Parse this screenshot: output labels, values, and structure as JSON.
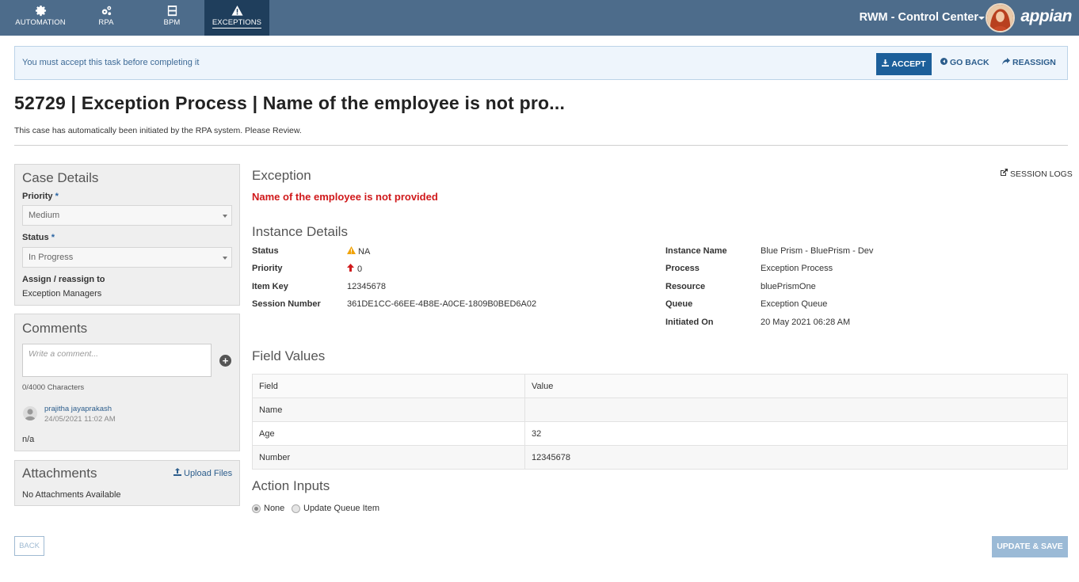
{
  "nav": {
    "tabs": [
      {
        "label": "AUTOMATION",
        "icon": "gear-icon"
      },
      {
        "label": "RPA",
        "icon": "gears-icon"
      },
      {
        "label": "BPM",
        "icon": "inbox-icon"
      },
      {
        "label": "EXCEPTIONS",
        "icon": "warning-icon",
        "active": true
      }
    ],
    "app_title": "RWM - Control Center",
    "logo": "appian"
  },
  "banner": {
    "message": "You must accept this task before completing it",
    "accept_label": "ACCEPT",
    "go_back_label": "GO BACK",
    "reassign_label": "REASSIGN"
  },
  "page": {
    "title": "52729 | Exception Process | Name of the employee is not pro...",
    "subtitle": "This case has automatically been initiated by the RPA system. Please Review."
  },
  "case_details": {
    "title": "Case Details",
    "priority_label": "Priority",
    "priority_value": "Medium",
    "status_label": "Status",
    "status_value": "In Progress",
    "required_mark": "*",
    "assign_label": "Assign / reassign to",
    "assign_value": "Exception Managers"
  },
  "comments": {
    "title": "Comments",
    "placeholder": "Write a comment...",
    "char_count": "0/4000 Characters",
    "entry": {
      "author": "prajitha jayaprakash",
      "timestamp": "24/05/2021 11:02 AM",
      "text": "n/a"
    }
  },
  "attachments": {
    "title": "Attachments",
    "upload_label": "Upload Files",
    "empty_text": "No Attachments Available"
  },
  "exception": {
    "title": "Exception",
    "message": "Name of the employee is not provided",
    "session_logs_label": "SESSION LOGS"
  },
  "instance": {
    "title": "Instance Details",
    "left": [
      {
        "label": "Status",
        "value": "NA",
        "icon": "warning-icon",
        "icon_color": "#f0a30a"
      },
      {
        "label": "Priority",
        "value": "0",
        "icon": "arrow-up-icon",
        "icon_color": "#d0191b"
      },
      {
        "label": "Item Key",
        "value": "12345678"
      },
      {
        "label": "Session Number",
        "value": "361DE1CC-66EE-4B8E-A0CE-1809B0BED6A02"
      }
    ],
    "right": [
      {
        "label": "Instance Name",
        "value": "Blue Prism - BluePrism - Dev"
      },
      {
        "label": "Process",
        "value": "Exception Process"
      },
      {
        "label": "Resource",
        "value": "bluePrismOne"
      },
      {
        "label": "Queue",
        "value": "Exception Queue"
      },
      {
        "label": "Initiated On",
        "value": "20 May 2021 06:28 AM"
      }
    ]
  },
  "field_values": {
    "title": "Field Values",
    "headers": [
      "Field",
      "Value"
    ],
    "rows": [
      [
        "Name",
        ""
      ],
      [
        "Age",
        "32"
      ],
      [
        "Number",
        "12345678"
      ]
    ]
  },
  "action_inputs": {
    "title": "Action Inputs",
    "options": [
      {
        "label": "None",
        "selected": true
      },
      {
        "label": "Update Queue Item",
        "selected": false
      }
    ]
  },
  "footer": {
    "back_label": "BACK",
    "save_label": "UPDATE & SAVE"
  }
}
